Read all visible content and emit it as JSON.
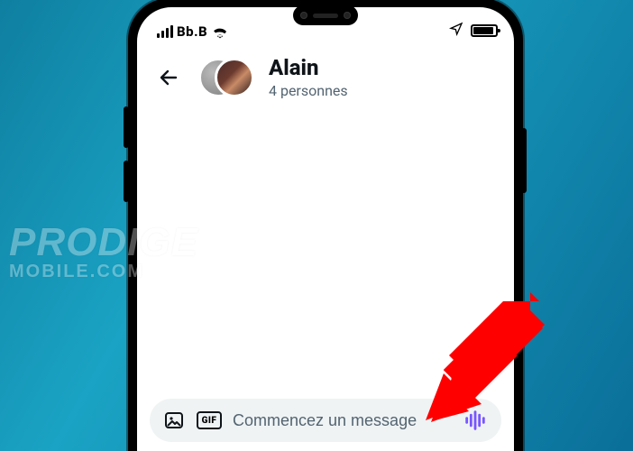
{
  "statusbar": {
    "carrier": "Bb.B"
  },
  "chat": {
    "title": "Alain",
    "subtitle": "4 personnes"
  },
  "composer": {
    "placeholder": "Commencez un message",
    "gif_label": "GIF"
  },
  "watermark": {
    "line1": "PRODIGE",
    "line2": "MOBILE.COM"
  }
}
